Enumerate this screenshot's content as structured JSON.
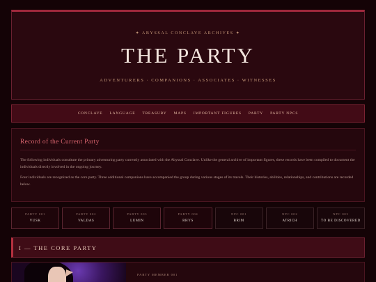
{
  "hero": {
    "eyebrow": "✦ ABYSSAL CONCLAVE ARCHIVES ✦",
    "title": "THE PARTY",
    "subtitle": "ADVENTURERS · COMPANIONS · ASSOCIATES · WITNESSES"
  },
  "nav": [
    {
      "label": "CONCLAVE"
    },
    {
      "label": "LANGUAGE"
    },
    {
      "label": "TREASURY"
    },
    {
      "label": "MAPS"
    },
    {
      "label": "IMPORTANT FIGURES"
    },
    {
      "label": "PARTY"
    },
    {
      "label": "PARTY NPCS"
    }
  ],
  "intro": {
    "heading": "Record of the Current Party",
    "p1": "The following individuals constitute the primary adventuring party currently associated with the Abyssal Conclave. Unlike the general archive of important figures, these records have been compiled to document the individuals directly involved in the ongoing journey.",
    "p2": "Four individuals are recognized as the core party. Three additional companions have accompanied the group during various stages of its travels. Their histories, abilities, relationships, and contributions are recorded below."
  },
  "tiles": [
    {
      "tag": "PARTY 001",
      "name": "VUSK",
      "kind": "party"
    },
    {
      "tag": "PARTY 002",
      "name": "VALDAS",
      "kind": "party"
    },
    {
      "tag": "PARTY 003",
      "name": "LUMIN",
      "kind": "party"
    },
    {
      "tag": "PARTY 004",
      "name": "RHYS",
      "kind": "party"
    },
    {
      "tag": "NPC 001",
      "name": "BRIM",
      "kind": "npc"
    },
    {
      "tag": "NPC 002",
      "name": "ATRICH",
      "kind": "npc"
    },
    {
      "tag": "NPC 003",
      "name": "TO BE DISCOVERED",
      "kind": "npc"
    }
  ],
  "section": {
    "label": "I — THE CORE PARTY"
  },
  "member": {
    "label": "PARTY MEMBER 001"
  }
}
